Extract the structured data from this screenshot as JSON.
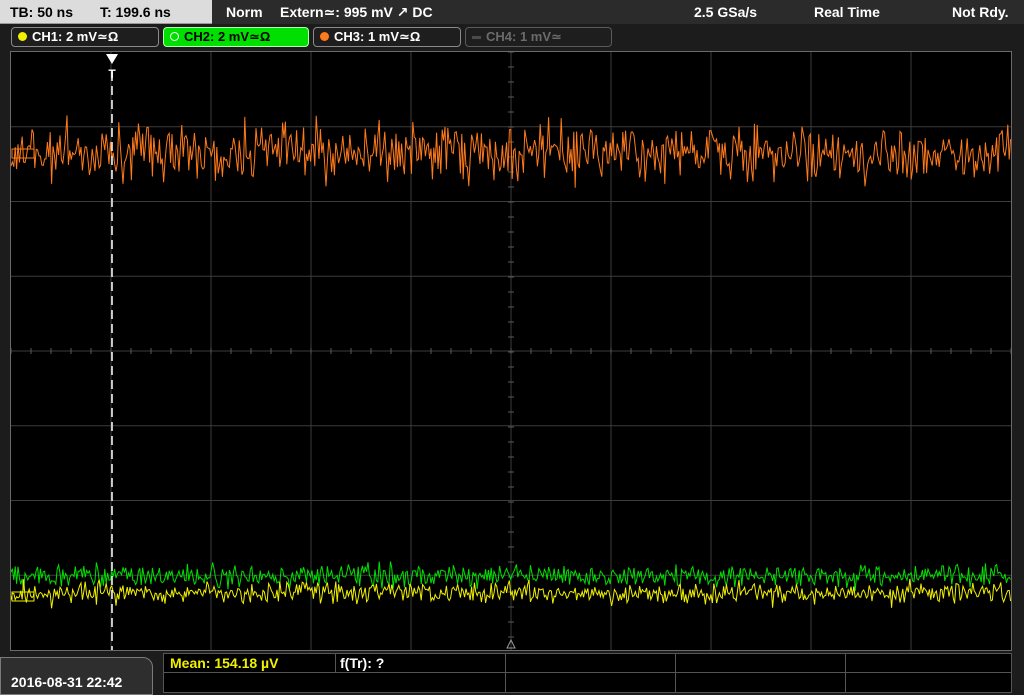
{
  "topbar": {
    "timebase": "TB: 50 ns",
    "trigger_time": "T: 199.6 ns",
    "trigger_mode": "Norm",
    "trigger_source": "Extern≃: 995 mV ↗ DC",
    "sample_rate": "2.5 GSa/s",
    "acq_mode": "Real Time",
    "status": "Not Rdy."
  },
  "channels": [
    {
      "label": "CH1: 2 mV≃Ω",
      "color": "#f0f000",
      "state": "normal"
    },
    {
      "label": "CH2: 2 mV≃Ω",
      "color": "#00e000",
      "state": "active"
    },
    {
      "label": "CH3: 1 mV≃Ω",
      "color": "#ff7a1a",
      "state": "normal"
    },
    {
      "label": "CH4: 1 mV≃",
      "color": "#6b6b6b",
      "state": "off"
    }
  ],
  "plot": {
    "trigger_marker": "T",
    "colors": {
      "ch1": "#f0f000",
      "ch2": "#00e000",
      "ch3": "#ff7a1a",
      "grid": "#3c3c3c"
    }
  },
  "bottom": {
    "datetime": "2016-08-31 22:42",
    "meas1": "Mean: 154.18 µV",
    "meas1_color": "#f0f000",
    "meas2": "f(Tr): ?"
  }
}
